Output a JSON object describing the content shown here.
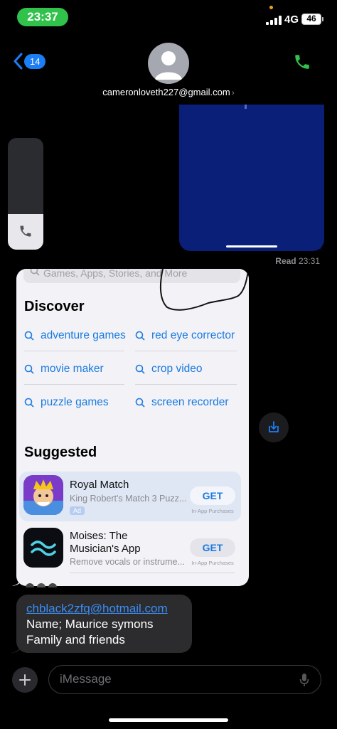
{
  "status_bar": {
    "time": "23:37",
    "network": "4G",
    "battery": "46"
  },
  "header": {
    "back_count": "14",
    "contact": "cameronloveth227@gmail.com"
  },
  "chat": {
    "read_label": "Read",
    "read_time": "23:31",
    "app_store": {
      "search_placeholder": "Games, Apps, Stories, and More",
      "discover_title": "Discover",
      "discover_items": [
        "adventure games",
        "red eye corrector",
        "movie maker",
        "crop video",
        "puzzle games",
        "screen recorder"
      ],
      "suggested_title": "Suggested",
      "apps": [
        {
          "name": "Royal Match",
          "subtitle": "King Robert's Match 3 Puzz...",
          "ad": "Ad",
          "button": "GET",
          "note": "In-App Purchases"
        },
        {
          "name_line1": "Moises: The",
          "name_line2": "Musician's App",
          "subtitle": "Remove vocals or instrume...",
          "button": "GET",
          "note": "In-App Purchases"
        }
      ]
    },
    "message": {
      "email": "chblack2zfq@hotmail.com",
      "line2": "Name; Maurice symons",
      "line3": "Family and friends"
    }
  },
  "input": {
    "placeholder": "iMessage"
  },
  "colors": {
    "accent": "#1b7ef5",
    "green": "#30c24a",
    "link": "#1a7ae0"
  }
}
